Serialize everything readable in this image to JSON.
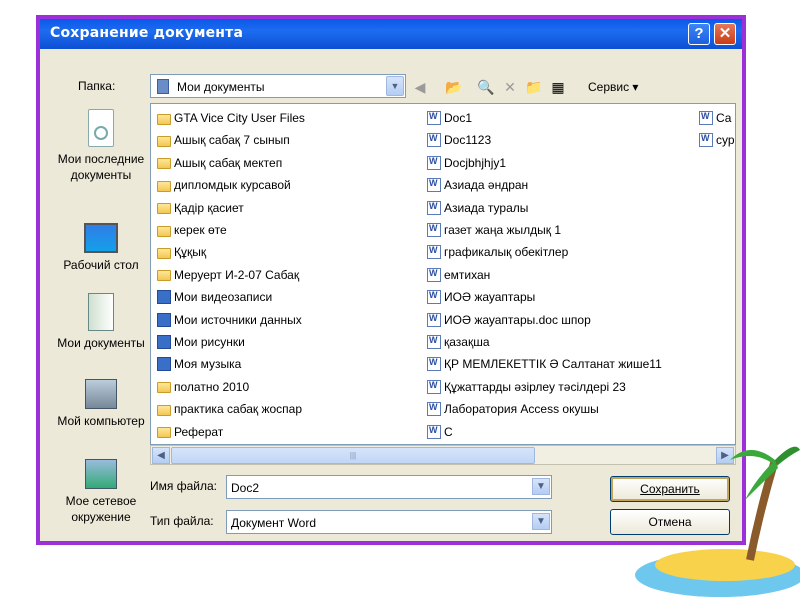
{
  "window": {
    "title": "Сохранение документа",
    "help_label": "?",
    "close_label": "✕"
  },
  "toolbar": {
    "folder_label": "Папка:",
    "folder_value": "Мои документы",
    "servis_label": "Сервис"
  },
  "places": [
    {
      "label": "Мои последние документы",
      "icon": "recent-docs-icon"
    },
    {
      "label": "Рабочий стол",
      "icon": "desktop-icon"
    },
    {
      "label": "Мои документы",
      "icon": "my-documents-icon"
    },
    {
      "label": "Мой компьютер",
      "icon": "my-computer-icon"
    },
    {
      "label": "Мое сетевое окружение",
      "icon": "network-icon"
    }
  ],
  "files": {
    "column1": [
      {
        "name": "GTA Vice City User Files",
        "type": "folder"
      },
      {
        "name": "Ашық сабақ 7 сынып",
        "type": "folder"
      },
      {
        "name": "Ашық сабақ мектеп",
        "type": "folder"
      },
      {
        "name": "дипломдык курсавой",
        "type": "folder"
      },
      {
        "name": "Қадір қасиет",
        "type": "folder"
      },
      {
        "name": "керек өте",
        "type": "folder"
      },
      {
        "name": "Құқық",
        "type": "folder"
      },
      {
        "name": "Меруерт И-2-07 Сабақ",
        "type": "folder"
      },
      {
        "name": "Мои видеозаписи",
        "type": "special"
      },
      {
        "name": "Мои источники данных",
        "type": "special"
      },
      {
        "name": "Мои рисунки",
        "type": "special"
      },
      {
        "name": "Моя музыка",
        "type": "special"
      },
      {
        "name": "полатно 2010",
        "type": "folder"
      },
      {
        "name": "практика сабақ жоспар",
        "type": "folder"
      },
      {
        "name": "Реферат",
        "type": "folder"
      }
    ],
    "column2": [
      {
        "name": "Doc1",
        "type": "doc"
      },
      {
        "name": "Doc1123",
        "type": "doc"
      },
      {
        "name": "Docjbhjhjy1",
        "type": "doc"
      },
      {
        "name": "Азиада әндран",
        "type": "doc"
      },
      {
        "name": "Азиада туралы",
        "type": "doc"
      },
      {
        "name": "газет жаңа жылдық 1",
        "type": "doc"
      },
      {
        "name": "графикалық обекітлер",
        "type": "doc"
      },
      {
        "name": "емтихан",
        "type": "doc"
      },
      {
        "name": "ИОӘ жауаптары",
        "type": "doc"
      },
      {
        "name": "ИОӘ жауаптары.doc шпор",
        "type": "doc"
      },
      {
        "name": "қазақша",
        "type": "doc"
      },
      {
        "name": "ҚР МЕМЛЕКЕТТІК Ә Салтанат жише11",
        "type": "doc"
      },
      {
        "name": "Құжаттарды әзірлеу тәсілдері 23",
        "type": "doc"
      },
      {
        "name": "Лаборатория Access окушы",
        "type": "doc"
      },
      {
        "name": "С",
        "type": "doc"
      }
    ],
    "column3": [
      {
        "name": "Са",
        "type": "doc"
      },
      {
        "name": "сур",
        "type": "doc"
      }
    ]
  },
  "form": {
    "filename_label": "Имя файла:",
    "filename_value": "Doc2",
    "filetype_label": "Тип файла:",
    "filetype_value": "Документ Word",
    "save_label": "Сохранить",
    "cancel_label": "Отмена"
  },
  "colors": {
    "frame": "#9b30d9",
    "titlebar": "#0a58e8"
  }
}
